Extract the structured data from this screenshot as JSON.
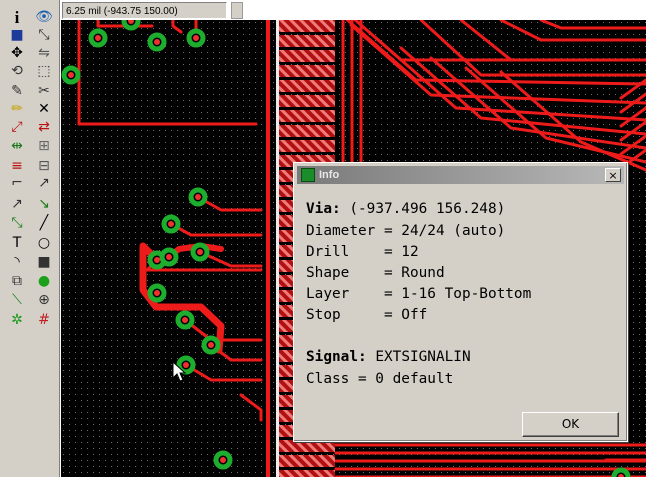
{
  "status_bar": {
    "coordinates": "6.25 mil (-943.75 150.00)"
  },
  "toolbar": {
    "tools": [
      {
        "name": "info-icon",
        "glyph": "i",
        "color": "#000000"
      },
      {
        "name": "show-icon",
        "glyph": "👁",
        "color": "#1a5fb4"
      },
      {
        "name": "display-icon",
        "glyph": "■",
        "color": "#1c3c9c"
      },
      {
        "name": "mark-icon",
        "glyph": "⤡",
        "color": "#333333"
      },
      {
        "name": "move-icon",
        "glyph": "✥",
        "color": "#000000"
      },
      {
        "name": "mirror-icon",
        "glyph": "⇋",
        "color": "#555555"
      },
      {
        "name": "rotate-icon",
        "glyph": "⟲",
        "color": "#333333"
      },
      {
        "name": "group-icon",
        "glyph": "⬚",
        "color": "#333333"
      },
      {
        "name": "change-icon",
        "glyph": "✎",
        "color": "#333333"
      },
      {
        "name": "cut-icon",
        "glyph": "✂",
        "color": "#333333"
      },
      {
        "name": "paste-icon",
        "glyph": "✏",
        "color": "#c0a000"
      },
      {
        "name": "delete-icon",
        "glyph": "✕",
        "color": "#000000"
      },
      {
        "name": "add-icon",
        "glyph": "⤢",
        "color": "#bb1111"
      },
      {
        "name": "replace-icon",
        "glyph": "⇄",
        "color": "#bb1111"
      },
      {
        "name": "lock-icon",
        "glyph": "⇹",
        "color": "#1a7a1a"
      },
      {
        "name": "smash-icon",
        "glyph": "⊞",
        "color": "#666666"
      },
      {
        "name": "split-icon",
        "glyph": "≡",
        "color": "#bb1111"
      },
      {
        "name": "optimize-icon",
        "glyph": "⊟",
        "color": "#555555"
      },
      {
        "name": "miter-icon",
        "glyph": "⌐",
        "color": "#333333"
      },
      {
        "name": "route-icon",
        "glyph": "↗",
        "color": "#333333"
      },
      {
        "name": "ripup-icon",
        "glyph": "↗",
        "color": "#333333"
      },
      {
        "name": "wire-icon",
        "glyph": "↘",
        "color": "#1a7a1a"
      },
      {
        "name": "polygon-icon",
        "glyph": "⤡",
        "color": "#1a7a1a"
      },
      {
        "name": "line-icon",
        "glyph": "╱",
        "color": "#000000"
      },
      {
        "name": "text-icon",
        "glyph": "T",
        "color": "#000000"
      },
      {
        "name": "circle-icon",
        "glyph": "○",
        "color": "#000000"
      },
      {
        "name": "arc-icon",
        "glyph": "◝",
        "color": "#000000"
      },
      {
        "name": "rect-icon",
        "glyph": "■",
        "color": "#333333"
      },
      {
        "name": "drc-icon",
        "glyph": "⧉",
        "color": "#333333"
      },
      {
        "name": "via-icon",
        "glyph": "●",
        "color": "#1aa01a"
      },
      {
        "name": "signal-icon",
        "glyph": "⟍",
        "color": "#1a7a1a"
      },
      {
        "name": "hole-icon",
        "glyph": "⊕",
        "color": "#333333"
      },
      {
        "name": "attribute-icon",
        "glyph": "✲",
        "color": "#1a9a1a"
      },
      {
        "name": "grid-icon",
        "glyph": "#",
        "color": "#c02020"
      }
    ]
  },
  "info_dialog": {
    "title": "Info",
    "close_label": "×",
    "via_label": "Via:",
    "via_coords": "(-937.496 156.248)",
    "diameter": "Diameter = 24/24 (auto)",
    "drill": "Drill    = 12",
    "shape": "Shape    = Round",
    "layer": "Layer    = 1-16 Top-Bottom",
    "stop": "Stop     = Off",
    "signal_label": "Signal:",
    "signal_value": "EXTSIGNALIN",
    "class_line": "Class = 0 default",
    "ok_label": "OK"
  },
  "colors": {
    "trace": "#ee1b1b",
    "via_ring": "#1eae2e",
    "via_hole": "#f03030",
    "board_background": "#000000",
    "grid_dot": "#6c6c6c",
    "dialog_face": "#d4d0c8"
  }
}
